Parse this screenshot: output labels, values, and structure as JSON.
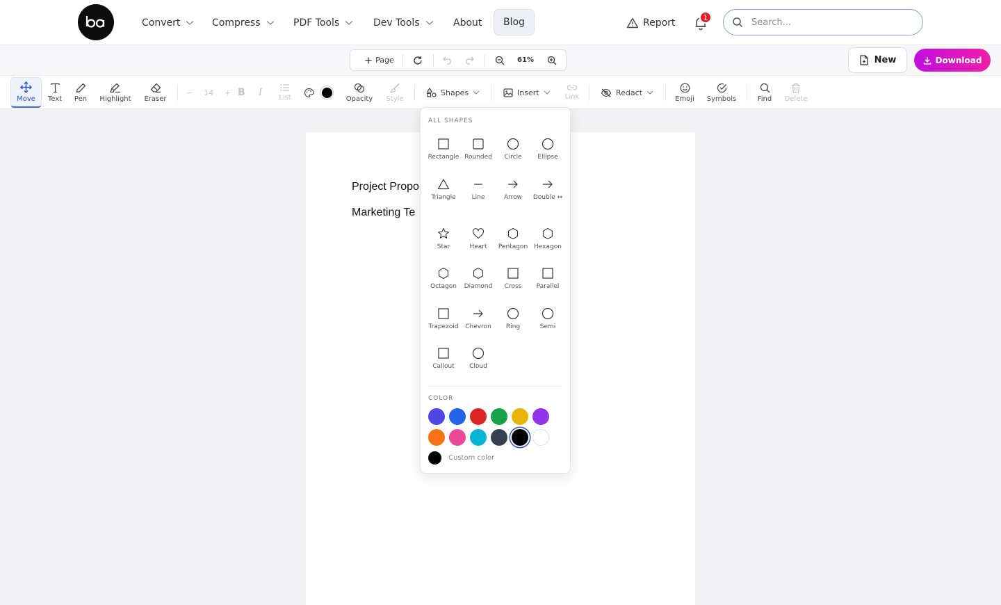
{
  "nav": {
    "logo_icon": "ba-logo",
    "menu": [
      {
        "label": "Convert",
        "dropdown": true
      },
      {
        "label": "Compress",
        "dropdown": true
      },
      {
        "label": "PDF Tools",
        "dropdown": true
      },
      {
        "label": "Dev Tools",
        "dropdown": true
      },
      {
        "label": "About",
        "dropdown": false
      },
      {
        "label": "Blog",
        "dropdown": false
      }
    ],
    "report_label": "Report",
    "notification_count": "1",
    "search_placeholder": "Search..."
  },
  "doc_controls": {
    "add_page_label": "Page",
    "zoom": "61%",
    "new_label": "New",
    "download_label": "Download"
  },
  "toolbar": {
    "move": "Move",
    "text": "Text",
    "pen": "Pen",
    "highlight": "Highlight",
    "eraser": "Eraser",
    "font_size": "14",
    "list": "List",
    "opacity": "Opacity",
    "style": "Style",
    "shapes": "Shapes",
    "insert": "Insert",
    "link": "Link",
    "redact": "Redact",
    "emoji": "Emoji",
    "symbols": "Symbols",
    "find": "Find",
    "delete": "Delete",
    "current_color": "#000000"
  },
  "document": {
    "lines": [
      "Project Propo",
      "Marketing Te"
    ]
  },
  "shapes_panel": {
    "heading": "ALL SHAPES",
    "shapes": [
      {
        "label": "Rectangle",
        "icon": "rectangle-icon"
      },
      {
        "label": "Rounded",
        "icon": "rounded-rect-icon"
      },
      {
        "label": "Circle",
        "icon": "circle-icon"
      },
      {
        "label": "Ellipse",
        "icon": "ellipse-icon"
      },
      {
        "label": "Triangle",
        "icon": "triangle-icon"
      },
      {
        "label": "Line",
        "icon": "line-icon"
      },
      {
        "label": "Arrow",
        "icon": "arrow-icon"
      },
      {
        "label": "Double ↔",
        "icon": "double-arrow-icon"
      },
      {
        "label": "Star",
        "icon": "star-icon"
      },
      {
        "label": "Heart",
        "icon": "heart-icon"
      },
      {
        "label": "Pentagon",
        "icon": "pentagon-icon"
      },
      {
        "label": "Hexagon",
        "icon": "hexagon-icon"
      },
      {
        "label": "Octagon",
        "icon": "octagon-icon"
      },
      {
        "label": "Diamond",
        "icon": "diamond-icon"
      },
      {
        "label": "Cross",
        "icon": "cross-icon"
      },
      {
        "label": "Parallel",
        "icon": "parallelogram-icon"
      },
      {
        "label": "Trapezoid",
        "icon": "trapezoid-icon"
      },
      {
        "label": "Chevron",
        "icon": "chevron-icon"
      },
      {
        "label": "Ring",
        "icon": "ring-icon"
      },
      {
        "label": "Semi",
        "icon": "semicircle-icon"
      },
      {
        "label": "Callout",
        "icon": "callout-icon"
      },
      {
        "label": "Cloud",
        "icon": "cloud-icon"
      }
    ],
    "color_heading": "COLOR",
    "colors": [
      "#4f46e5",
      "#2563eb",
      "#dc2626",
      "#16a34a",
      "#eab308",
      "#9333ea",
      "#f97316",
      "#ec4899",
      "#06b6d4",
      "#374151",
      "#000000",
      "#ffffff"
    ],
    "selected_color": "#000000",
    "custom_label": "Custom color"
  }
}
